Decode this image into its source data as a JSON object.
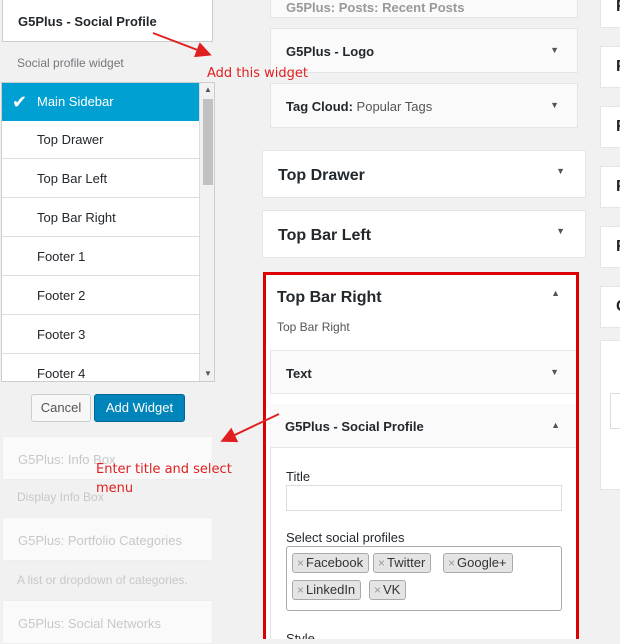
{
  "chooser": {
    "widget_name": "G5Plus - Social Profile",
    "widget_desc": "Social profile widget",
    "sidebars": [
      "Main Sidebar",
      "Top Drawer",
      "Top Bar Left",
      "Top Bar Right",
      "Footer 1",
      "Footer 2",
      "Footer 3",
      "Footer 4"
    ],
    "cancel_label": "Cancel",
    "add_label": "Add Widget"
  },
  "available_widgets": [
    {
      "name": "G5Plus: Info Box",
      "desc": "Display Info Box"
    },
    {
      "name": "G5Plus: Portfolio Categories",
      "desc": "A list or dropdown of categories."
    },
    {
      "name": "G5Plus: Social Networks",
      "desc": ""
    }
  ],
  "annotations": {
    "add_widget": "Add this widget",
    "enter_title_line1": "Enter title and select",
    "enter_title_line2": "menu"
  },
  "main_sidebar_widgets": {
    "partial_top": "G5Plus: Posts: Recent Posts",
    "logo": "G5Plus - Logo",
    "tag_cloud_prefix": "Tag Cloud:",
    "tag_cloud_value": "Popular Tags"
  },
  "sidebars": {
    "top_drawer": "Top Drawer",
    "top_bar_left": "Top Bar Left",
    "top_bar_right": "Top Bar Right",
    "top_bar_right_desc": "Top Bar Right"
  },
  "top_bar_right_widgets": {
    "text": "Text",
    "social_profile": "G5Plus - Social Profile"
  },
  "social_form": {
    "title_label": "Title",
    "title_value": "",
    "profiles_label": "Select social profiles",
    "profiles": [
      "Facebook",
      "Twitter",
      "Google+",
      "LinkedIn",
      "VK"
    ],
    "style_label": "Style"
  },
  "right_column_letters": [
    "F",
    "F",
    "F",
    "F",
    "F",
    "F",
    "C"
  ],
  "colors": {
    "accent": "#00a0d2",
    "primary_button": "#0085ba",
    "annotation": "#e02020",
    "highlight_border": "#dd0000"
  }
}
